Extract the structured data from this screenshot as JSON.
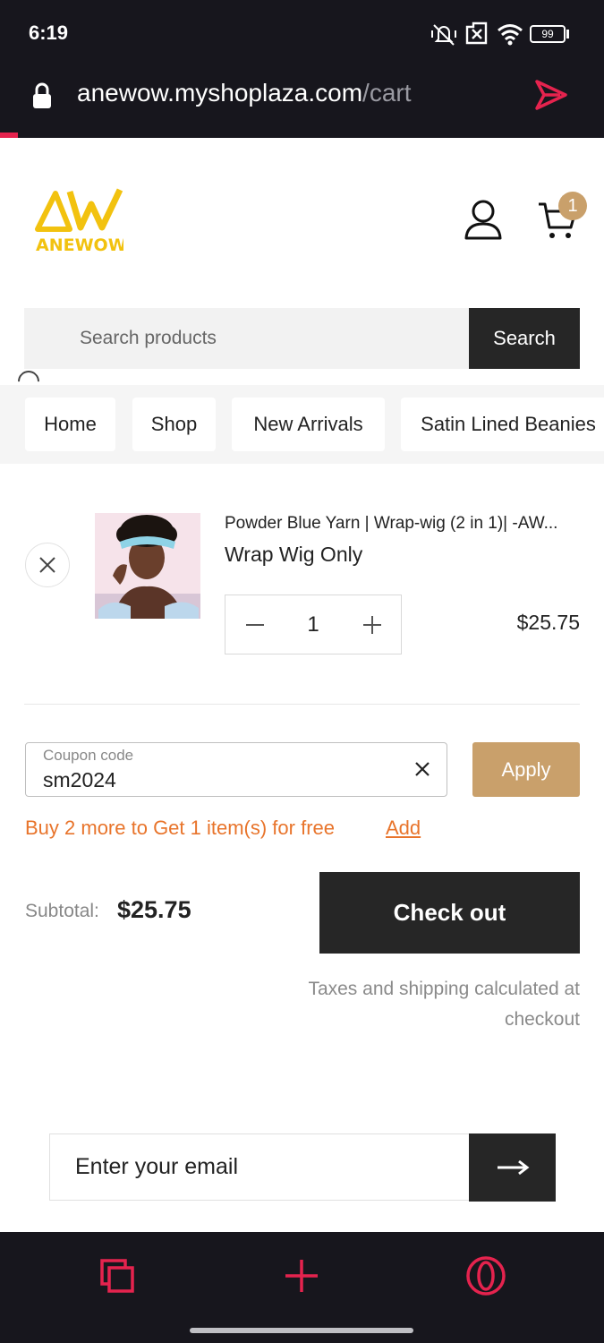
{
  "status_bar": {
    "time": "6:19",
    "battery": "99",
    "icons": [
      "mute-vibrate-icon",
      "no-sim-icon",
      "wifi-icon",
      "battery-icon"
    ]
  },
  "browser": {
    "url_domain": "anewow.myshoplaza.com",
    "url_path": "/cart",
    "accent": "#e5234e",
    "bottom_icons": [
      "tabs-icon",
      "new-tab-plus-icon",
      "opera-menu-icon"
    ]
  },
  "header": {
    "brand": "ANEWOW",
    "brand_color": "#f2c20f",
    "cart_count": "1",
    "badge_color": "#c9a06b"
  },
  "search": {
    "placeholder": "Search products",
    "button_label": "Search"
  },
  "nav": {
    "items": [
      "Home",
      "Shop",
      "New Arrivals",
      "Satin Lined Beanies"
    ]
  },
  "cart": {
    "item": {
      "title": "Powder Blue Yarn | Wrap-wig (2 in 1)| -AW...",
      "variant": "Wrap Wig Only",
      "quantity": "1",
      "price": "$25.75"
    }
  },
  "coupon": {
    "label": "Coupon code",
    "value": "sm2024",
    "apply_label": "Apply",
    "apply_color": "#c9a06b"
  },
  "promo": {
    "text": "Buy 2 more to Get 1 item(s) for free",
    "link": "Add",
    "color": "#e8742b"
  },
  "summary": {
    "subtotal_label": "Subtotal:",
    "subtotal_value": "$25.75",
    "checkout_label": "Check out",
    "tax_note": "Taxes and shipping calculated at checkout"
  },
  "newsletter": {
    "placeholder": "Enter your email"
  }
}
